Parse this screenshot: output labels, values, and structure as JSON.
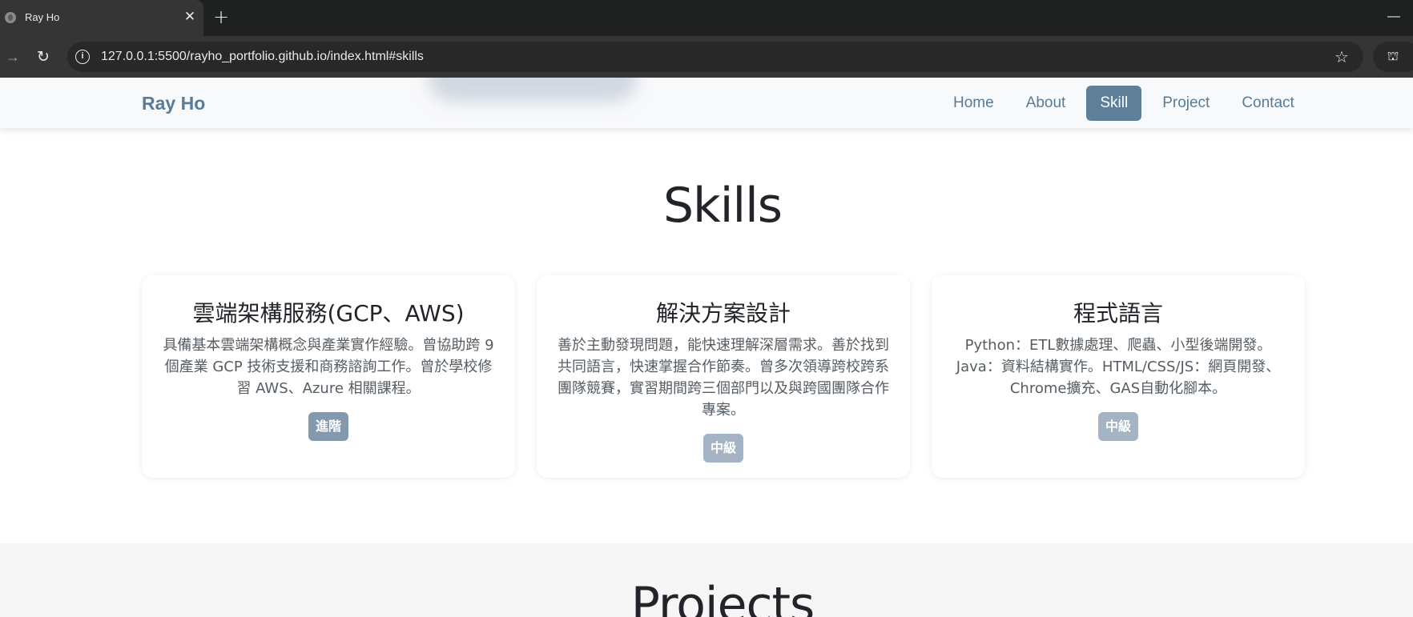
{
  "browser": {
    "tab_title": "Ray Ho",
    "close_glyph": "✕",
    "new_tab_glyph": "+",
    "minimize_glyph": "—",
    "forward_glyph": "→",
    "reload_glyph": "↻",
    "info_glyph": "i",
    "star_glyph": "☆",
    "incognito_glyph": "⛫",
    "url": "127.0.0.1:5500/rayho_portfolio.github.io/index.html#skills"
  },
  "navbar": {
    "brand": "Ray Ho",
    "links": [
      {
        "label": "Home"
      },
      {
        "label": "About"
      },
      {
        "label": "Skill",
        "active": true
      },
      {
        "label": "Project"
      },
      {
        "label": "Contact"
      }
    ]
  },
  "skills": {
    "title": "Skills",
    "cards": [
      {
        "title": "雲端架構服務(GCP、AWS)",
        "description": "具備基本雲端架構概念與產業實作經驗。曾協助跨 9 個產業 GCP 技術支援和商務諮詢工作。曾於學校修習 AWS、Azure 相關課程。",
        "level": "進階",
        "level_color": "#8399ad"
      },
      {
        "title": "解決方案設計",
        "description": "善於主動發現問題，能快速理解深層需求。善於找到共同語言，快速掌握合作節奏。曾多次領導跨校跨系團隊競賽，實習期間跨三個部門以及與跨國團隊合作專案。",
        "level": "中級",
        "level_color": "#a5b4c4"
      },
      {
        "title": "程式語言",
        "description": "Python：ETL數據處理、爬蟲、小型後端開發。Java：資料結構實作。HTML/CSS/JS：網頁開發、Chrome擴充、GAS自動化腳本。",
        "level": "中級",
        "level_color": "#a5b4c4"
      }
    ]
  },
  "projects": {
    "title": "Projects"
  }
}
